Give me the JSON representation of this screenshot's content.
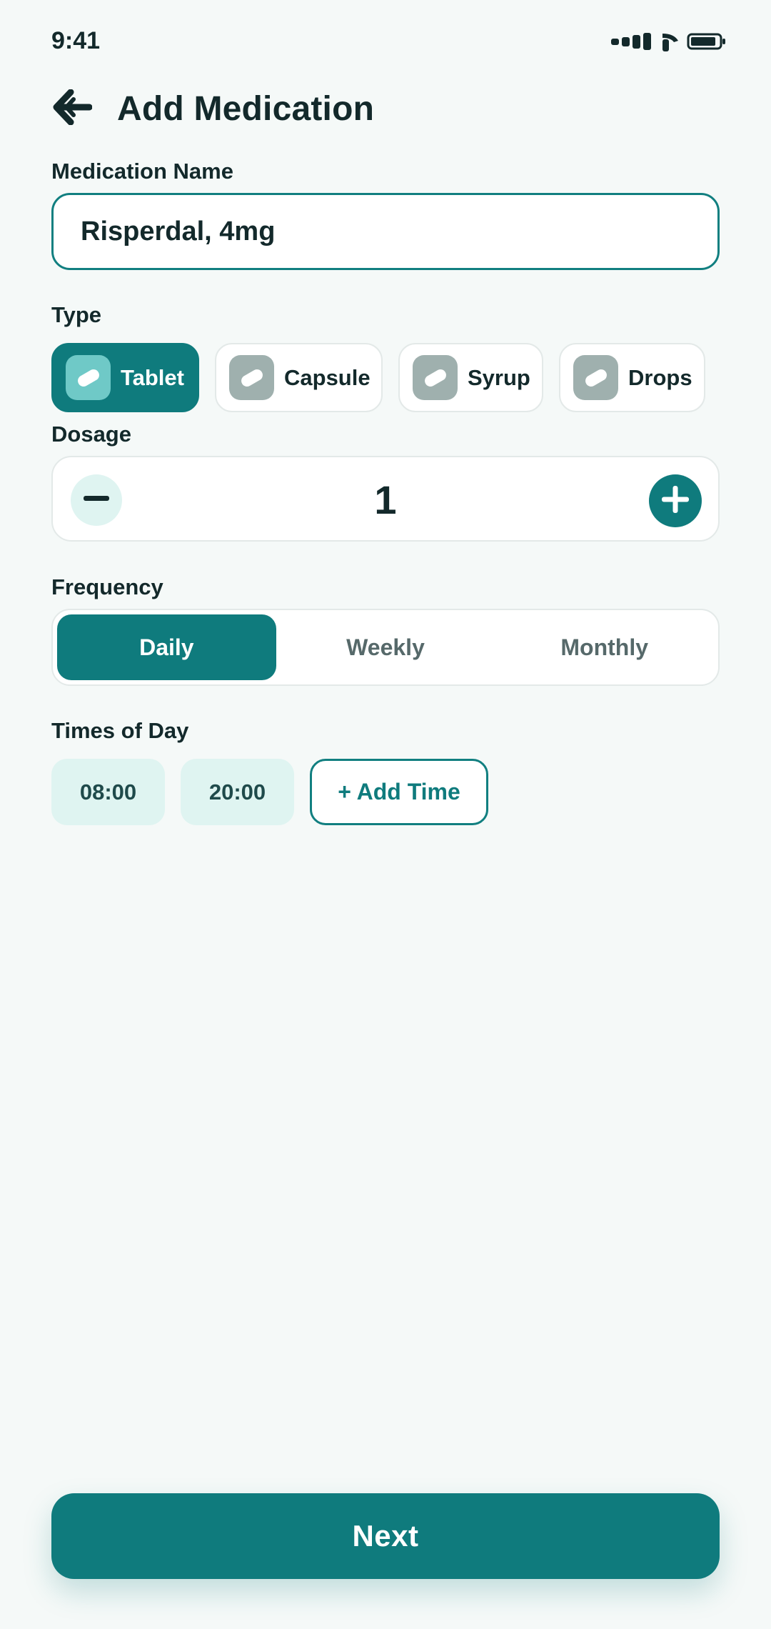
{
  "status_bar": {
    "time": "9:41",
    "icons": [
      "signal-icon",
      "wifi-icon",
      "battery-icon"
    ]
  },
  "header": {
    "back_icon": "arrow-left-icon",
    "title": "Add Medication"
  },
  "medication_name": {
    "label": "Medication Name",
    "value": "Risperdal, 4mg"
  },
  "type": {
    "label": "Type",
    "selected": "Tablet",
    "options": [
      {
        "label": "Tablet",
        "icon": "pill-icon",
        "active": true
      },
      {
        "label": "Capsule",
        "icon": "pill-icon",
        "active": false
      },
      {
        "label": "Syrup",
        "icon": "pill-icon",
        "active": false
      },
      {
        "label": "Drops",
        "icon": "pill-icon",
        "active": false
      }
    ]
  },
  "dosage": {
    "label": "Dosage",
    "value": "1",
    "decrement_icon": "minus-icon",
    "increment_icon": "plus-icon"
  },
  "frequency": {
    "label": "Frequency",
    "selected": "Daily",
    "options": [
      "Daily",
      "Weekly",
      "Monthly"
    ]
  },
  "times_of_day": {
    "label": "Times of Day",
    "times": [
      "08:00",
      "20:00"
    ],
    "add_label": "+ Add Time"
  },
  "footer": {
    "next_label": "Next"
  },
  "colors": {
    "primary": "#0f7b7d",
    "primary_light": "#dff4f1",
    "background": "#f5f9f8",
    "text": "#13292b",
    "muted": "#56696a"
  }
}
